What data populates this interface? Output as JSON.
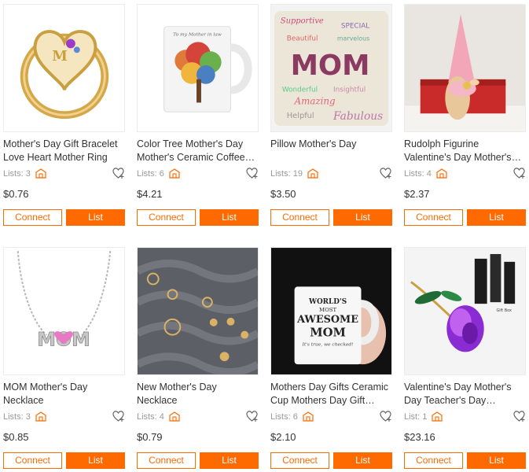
{
  "products": [
    {
      "title": "Mother's Day Gift Bracelet Love Heart Mother Ring",
      "lists_label": "Lists: 3",
      "price": "$0.76",
      "connect_label": "Connect",
      "list_label": "List"
    },
    {
      "title": "Color Tree Mother's Day Mother's Ceramic Coffee…",
      "lists_label": "Lists: 6",
      "price": "$4.21",
      "connect_label": "Connect",
      "list_label": "List",
      "image_caption": "To my Mother in law"
    },
    {
      "title": "Pillow Mother's Day",
      "lists_label": "Lists: 19",
      "price": "$3.50",
      "connect_label": "Connect",
      "list_label": "List",
      "image_text": "MOM"
    },
    {
      "title": "Rudolph Figurine Valentine's Day Mother's Day",
      "lists_label": "Lists: 4",
      "price": "$2.37",
      "connect_label": "Connect",
      "list_label": "List"
    },
    {
      "title": "MOM Mother's Day Necklace",
      "lists_label": "Lists: 3",
      "price": "$0.85",
      "connect_label": "Connect",
      "list_label": "List",
      "image_text": "MOM"
    },
    {
      "title": "New Mother's Day Necklace",
      "lists_label": "Lists: 4",
      "price": "$0.79",
      "connect_label": "Connect",
      "list_label": "List"
    },
    {
      "title": "Mothers Day Gifts Ceramic Cup Mothers Day Gift Cup…",
      "lists_label": "Lists: 6",
      "price": "$2.10",
      "connect_label": "Connect",
      "list_label": "List",
      "image_text": [
        "WORLD'S",
        "MOST",
        "AWESOME",
        "MOM",
        "It's true, we checked!"
      ]
    },
    {
      "title": "Valentine's Day Mother's Day Teacher's Day Colore…",
      "lists_label": "List: 1",
      "price": "$23.16",
      "connect_label": "Connect",
      "list_label": "List",
      "image_text": "Gift Box"
    }
  ],
  "colors": {
    "accent": "#ff6a00",
    "muted_text": "#999999"
  },
  "icons": {
    "store": "store-icon",
    "favorite": "heart-icon"
  }
}
